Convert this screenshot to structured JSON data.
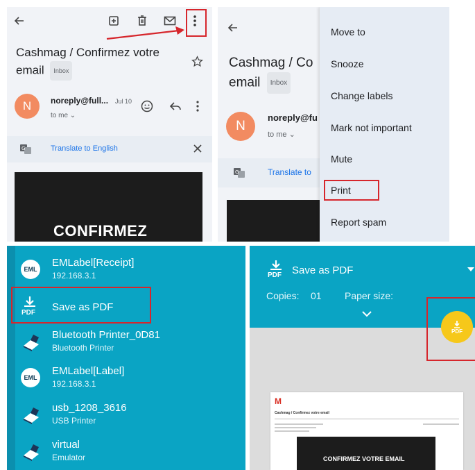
{
  "email": {
    "subject": "Cashmag / Confirmez votre email",
    "subject_line1": "Cashmag / Confirmez votre",
    "subject_line2": "email",
    "label_chip": "Inbox",
    "sender": "noreply@full...",
    "date": "Jul 10",
    "recipient": "to me",
    "avatar_letter": "N",
    "translate": "Translate to English",
    "banner": "CONFIRMEZ"
  },
  "email_menu_view": {
    "subject_partial_line1": "Cashmag / Co",
    "subject_line2": "email",
    "label_chip": "Inbox",
    "sender_partial": "noreply@fu",
    "recipient": "to me",
    "avatar_letter": "N",
    "translate_partial": "Translate to"
  },
  "overflow_menu": {
    "items": [
      "Move to",
      "Snooze",
      "Change labels",
      "Mark not important",
      "Mute",
      "Print",
      "Report spam"
    ],
    "highlighted": "Print"
  },
  "printers": [
    {
      "name": "EMLabel[Receipt]",
      "detail": "192.168.3.1",
      "icon": "emlabel-logo-icon"
    },
    {
      "name": "Save as PDF",
      "detail": "",
      "icon": "pdf-download-icon"
    },
    {
      "name": "Bluetooth Printer_0D81",
      "detail": "Bluetooth Printer",
      "icon": "printer-icon"
    },
    {
      "name": "EMLabel[Label]",
      "detail": "192.168.3.1",
      "icon": "emlabel-logo-icon"
    },
    {
      "name": "usb_1208_3616",
      "detail": "USB Printer",
      "icon": "printer-icon"
    },
    {
      "name": "virtual",
      "detail": "Emulator",
      "icon": "printer-icon"
    }
  ],
  "logo_text": "EML",
  "pdf_icon_text": "PDF",
  "print_preview": {
    "destination": "Save as PDF",
    "copies_label": "Copies:",
    "copies_value": "01",
    "paper_size_label": "Paper size:",
    "fab_text": "PDF",
    "doc_logo": "M",
    "doc_subject": "Cashmag / Confirmez votre email",
    "doc_banner": "CONFIRMEZ VOTRE EMAIL"
  },
  "colors": {
    "highlight_red": "#d6262c",
    "teal": "#0aa4c4",
    "avatar": "#f28b61",
    "fab_yellow": "#f6c81a",
    "link_blue": "#1a73e8"
  }
}
